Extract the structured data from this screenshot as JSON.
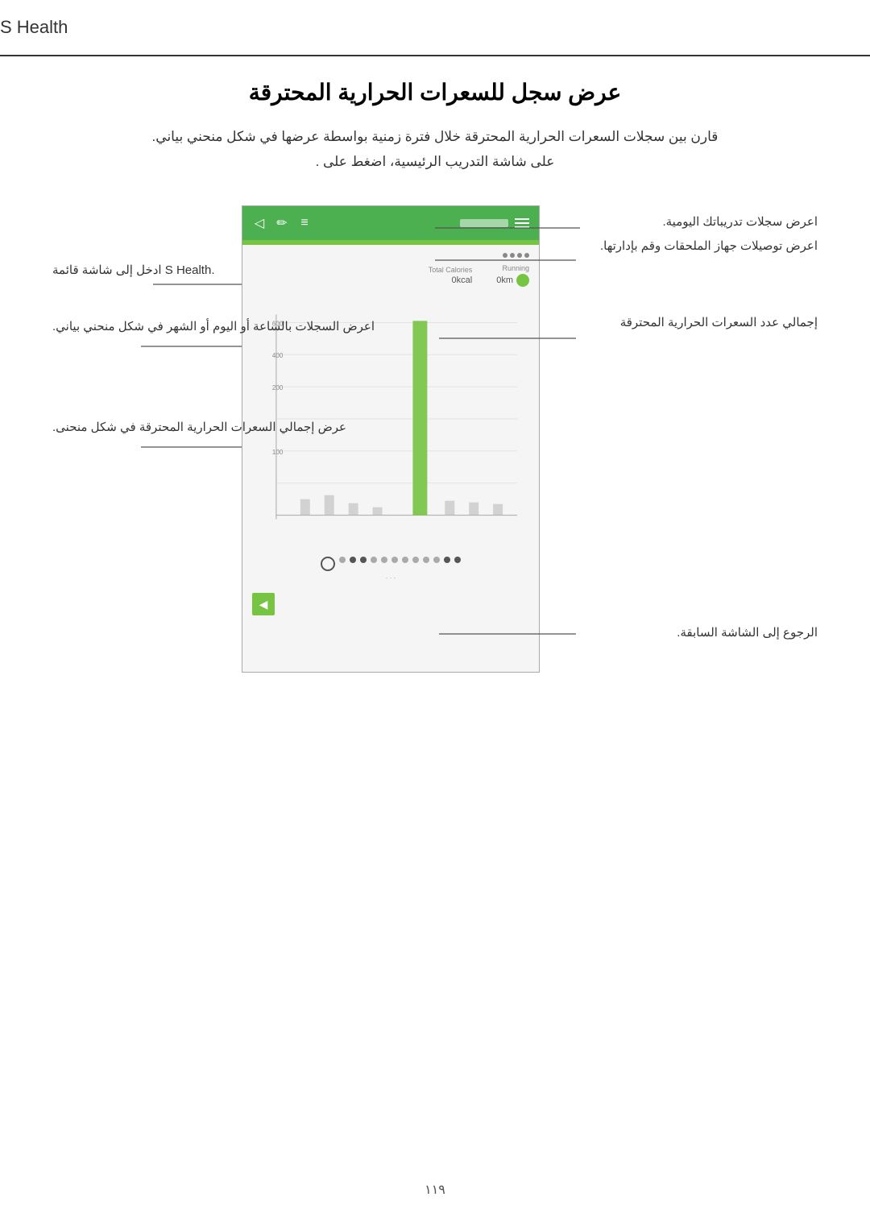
{
  "header": {
    "title": "S Health",
    "border_color": "#333333"
  },
  "page": {
    "title": "عرض سجل للسعرات الحرارية المحترقة",
    "subtitle_line1": "قارن بين سجلات السعرات الحرارية المحترقة خلال فترة زمنية بواسطة عرضها في شكل منحني بياني.",
    "subtitle_line2": "على شاشة التدريب الرئيسية، اضغط على  .",
    "page_number": "١١٩"
  },
  "annotations": {
    "daily_records": "اعرض سجلات تدريباتك اليومية.",
    "accessories": "اعرض توصيلات جهاز الملحقات وقم\nبإدارتها.",
    "go_home": ".S Health ادخل إلى شاشة قائمة",
    "view_records": "اعرض السجلات بالساعة أو اليوم أو\nالشهر في شكل منحني بياني.",
    "total_calories": "إجمالي عدد السعرات الحرارية المحترقة",
    "curve_chart": "عرض إجمالي السعرات الحرارية المحترقة\nفي شكل منحنى.",
    "back": "الرجوع إلى الشاشة السابقة."
  },
  "phone": {
    "top_bar_color": "#4CAF50",
    "accent_bar_color": "#76c442",
    "chart": {
      "bar_color": "#76c442",
      "grid_color": "#ddd",
      "axis_color": "#aaa"
    }
  },
  "icons": {
    "hamburger": "☰",
    "list": "≡",
    "edit": "✏",
    "share": "◁",
    "back_arrow": "◀"
  }
}
